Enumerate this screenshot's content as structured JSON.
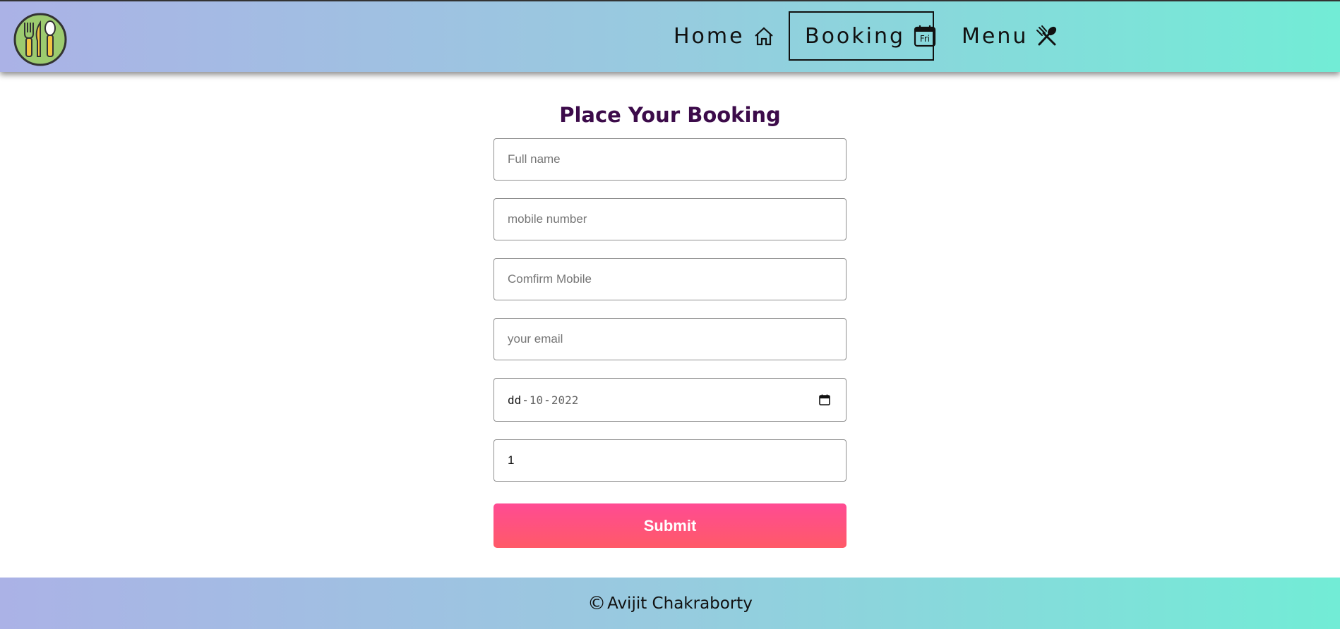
{
  "header": {
    "logo_icon": "cutlery-plate-icon",
    "nav": [
      {
        "label": "Home",
        "icon": "home-icon"
      },
      {
        "label": "Booking",
        "icon": "calendar-icon",
        "icon_text": "Fri",
        "active": true
      },
      {
        "label": "Menu",
        "icon": "fork-spoon-icon"
      }
    ]
  },
  "form": {
    "title": "Place Your Booking",
    "full_name_placeholder": "Full name",
    "mobile_placeholder": "mobile number",
    "confirm_mobile_placeholder": "Comfirm Mobile",
    "email_placeholder": "your email",
    "date": {
      "day": "dd",
      "month": "10",
      "year": "2022",
      "separator": "-"
    },
    "guests_value": "1",
    "submit_label": "Submit"
  },
  "footer": {
    "copyright_symbol": "©",
    "author": "Avijit Chakraborty"
  },
  "colors": {
    "gradient_start": "#abb2e6",
    "gradient_end": "#72ecd6",
    "title_color": "#3c0b4a",
    "submit_top": "#ff4b93",
    "submit_bottom": "#ff5a68"
  }
}
